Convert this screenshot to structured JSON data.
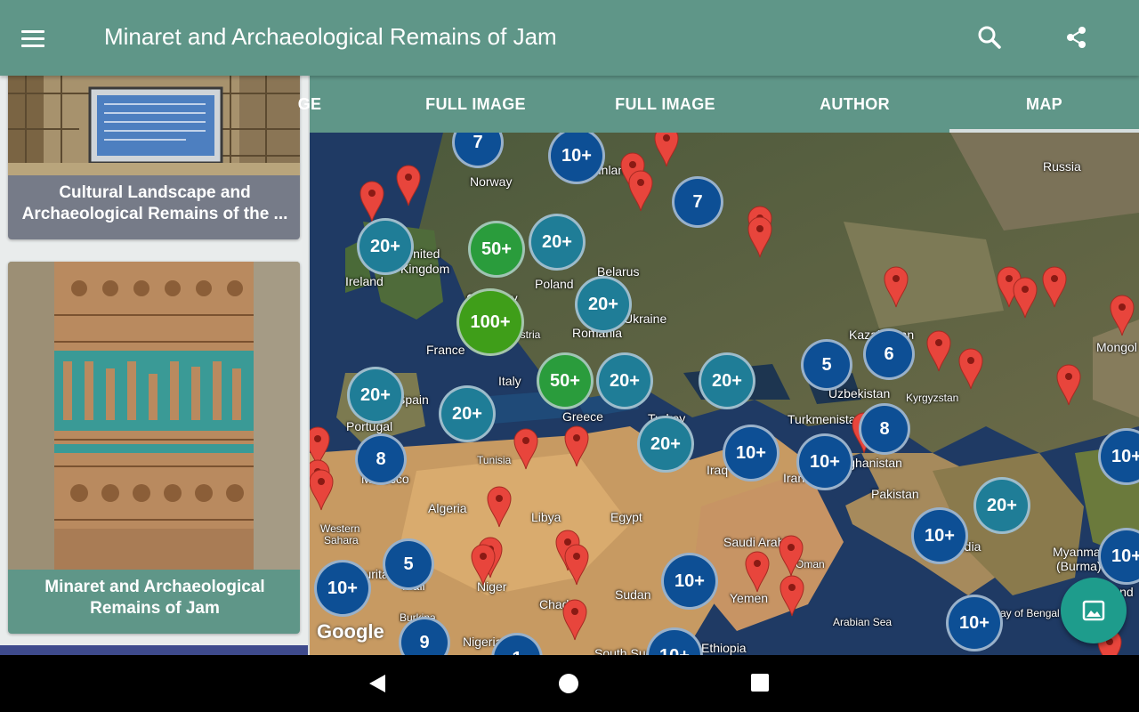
{
  "app_bar": {
    "title": "Minaret and Archaeological Remains of Jam",
    "menu_icon": "hamburger-menu-icon",
    "search_icon": "search-icon",
    "share_icon": "share-icon",
    "background": "#5f9688"
  },
  "list": {
    "cards": [
      {
        "caption_line1": "Cultural Landscape and",
        "caption_line2": "Archaeological Remains of the ...",
        "background": "#767b88"
      },
      {
        "caption_line1": "Minaret and Archaeological",
        "caption_line2": "Remains of Jam",
        "background": "#5f9688"
      }
    ]
  },
  "tabs": {
    "items": [
      {
        "label": "GE"
      },
      {
        "label": "FULL IMAGE"
      },
      {
        "label": "FULL IMAGE"
      },
      {
        "label": "AUTHOR"
      },
      {
        "label": "MAP"
      }
    ],
    "selected": "MAP"
  },
  "map": {
    "attribution": "Google",
    "fab_icon": "image-icon",
    "places": [
      "Norway",
      "Russia",
      "United",
      "Kingdom",
      "Ireland",
      "Belarus",
      "Poland",
      "Ukraine",
      "France",
      "Austria",
      "Romania",
      "Kazakhstan",
      "Mongol",
      "Italy",
      "Spain",
      "Portugal",
      "Greece",
      "Turkey",
      "Uzbekistan",
      "Kyrgyzstan",
      "Turkmenistan",
      "Tunisia",
      "Morocco",
      "Afghanistan",
      "Iraq",
      "Iran",
      "Algeria",
      "Libya",
      "Egypt",
      "Pakistan",
      "India",
      "Western",
      "Sahara",
      "Saudi Arabia",
      "Myanmar",
      "(Burma)",
      "Oman",
      "Mali",
      "Niger",
      "Chad",
      "Sudan",
      "Yemen",
      "Arabian Sea",
      "Bay of Bengal",
      "Burkina",
      "Nigeria",
      "South Sudan",
      "Ethiopia",
      "Finland",
      "Germany",
      "Mauritania",
      "Thailand"
    ],
    "clusters": [
      {
        "label": "7",
        "color": "#0d4f95"
      },
      {
        "label": "10+",
        "color": "#0d4f95"
      },
      {
        "label": "7",
        "color": "#0d4f95"
      },
      {
        "label": "20+",
        "color": "#1f7d97"
      },
      {
        "label": "50+",
        "color": "#2a9c3c"
      },
      {
        "label": "20+",
        "color": "#1f7d97"
      },
      {
        "label": "100+",
        "color": "#3f9e19"
      },
      {
        "label": "20+",
        "color": "#1f7d97"
      },
      {
        "label": "5",
        "color": "#0d4f95"
      },
      {
        "label": "6",
        "color": "#0d4f95"
      },
      {
        "label": "20+",
        "color": "#1f7d97"
      },
      {
        "label": "50+",
        "color": "#2a9c3c"
      },
      {
        "label": "20+",
        "color": "#1f7d97"
      },
      {
        "label": "20+",
        "color": "#1f7d97"
      },
      {
        "label": "20+",
        "color": "#1f7d97"
      },
      {
        "label": "8",
        "color": "#0d4f95"
      },
      {
        "label": "20+",
        "color": "#1f7d97"
      },
      {
        "label": "10+",
        "color": "#0d4f95"
      },
      {
        "label": "10+",
        "color": "#0d4f95"
      },
      {
        "label": "8",
        "color": "#0d4f95"
      },
      {
        "label": "10+",
        "color": "#0d4f95"
      },
      {
        "label": "20+",
        "color": "#1f7d97"
      },
      {
        "label": "10+",
        "color": "#0d4f95"
      },
      {
        "label": "10+",
        "color": "#0d4f95"
      },
      {
        "label": "5",
        "color": "#0d4f95"
      },
      {
        "label": "10+",
        "color": "#0d4f95"
      },
      {
        "label": "10+",
        "color": "#0d4f95"
      },
      {
        "label": "10+",
        "color": "#0d4f95"
      },
      {
        "label": "9",
        "color": "#0d4f95"
      },
      {
        "label": "1",
        "color": "#0d4f95"
      },
      {
        "label": "10+",
        "color": "#0d4f95"
      }
    ],
    "pin_color": "#e8453c"
  },
  "nav_bar": {
    "back_icon": "back-triangle-icon",
    "home_icon": "home-circle-icon",
    "recents_icon": "recents-square-icon"
  }
}
